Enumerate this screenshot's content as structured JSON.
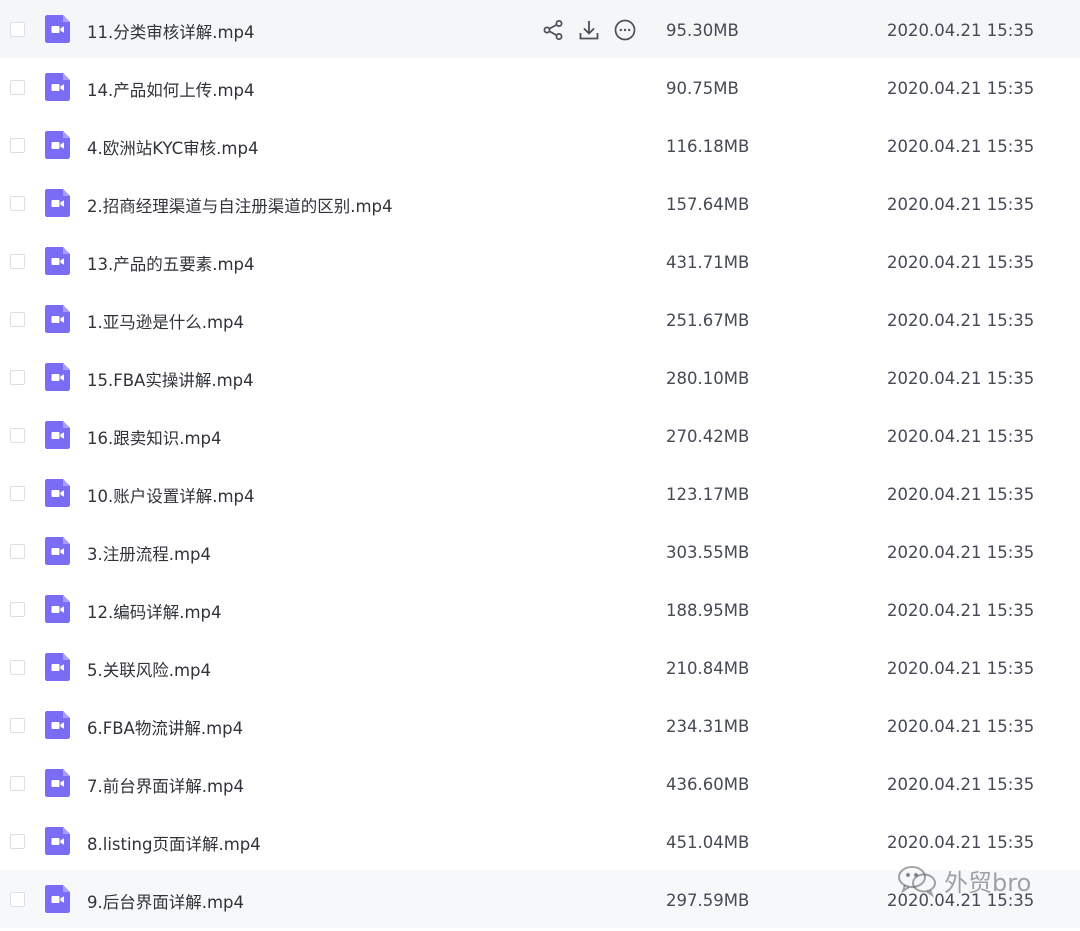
{
  "files": [
    {
      "name": "11.分类审核详解.mp4",
      "size": "95.30MB",
      "date": "2020.04.21 15:35",
      "hovered": true
    },
    {
      "name": "14.产品如何上传.mp4",
      "size": "90.75MB",
      "date": "2020.04.21 15:35"
    },
    {
      "name": "4.欧洲站KYC审核.mp4",
      "size": "116.18MB",
      "date": "2020.04.21 15:35"
    },
    {
      "name": "2.招商经理渠道与自注册渠道的区别.mp4",
      "size": "157.64MB",
      "date": "2020.04.21 15:35"
    },
    {
      "name": "13.产品的五要素.mp4",
      "size": "431.71MB",
      "date": "2020.04.21 15:35"
    },
    {
      "name": "1.亚马逊是什么.mp4",
      "size": "251.67MB",
      "date": "2020.04.21 15:35"
    },
    {
      "name": "15.FBA实操讲解.mp4",
      "size": "280.10MB",
      "date": "2020.04.21 15:35"
    },
    {
      "name": "16.跟卖知识.mp4",
      "size": "270.42MB",
      "date": "2020.04.21 15:35"
    },
    {
      "name": "10.账户设置详解.mp4",
      "size": "123.17MB",
      "date": "2020.04.21 15:35"
    },
    {
      "name": "3.注册流程.mp4",
      "size": "303.55MB",
      "date": "2020.04.21 15:35"
    },
    {
      "name": "12.编码详解.mp4",
      "size": "188.95MB",
      "date": "2020.04.21 15:35"
    },
    {
      "name": "5.关联风险.mp4",
      "size": "210.84MB",
      "date": "2020.04.21 15:35"
    },
    {
      "name": "6.FBA物流讲解.mp4",
      "size": "234.31MB",
      "date": "2020.04.21 15:35"
    },
    {
      "name": "7.前台界面详解.mp4",
      "size": "436.60MB",
      "date": "2020.04.21 15:35"
    },
    {
      "name": "8.listing页面详解.mp4",
      "size": "451.04MB",
      "date": "2020.04.21 15:35"
    },
    {
      "name": "9.后台界面详解.mp4",
      "size": "297.59MB",
      "date": "2020.04.21 15:35"
    }
  ],
  "row_actions": [
    {
      "icon": "share-icon"
    },
    {
      "icon": "download-icon"
    },
    {
      "icon": "more-icon"
    }
  ],
  "watermark": {
    "text": "外贸bro",
    "icon": "wechat-icon"
  },
  "colors": {
    "video_icon": "#7b6cf6",
    "hover_row": "#f5f6f8",
    "text": "#30333a",
    "meta_text": "#454a55"
  }
}
